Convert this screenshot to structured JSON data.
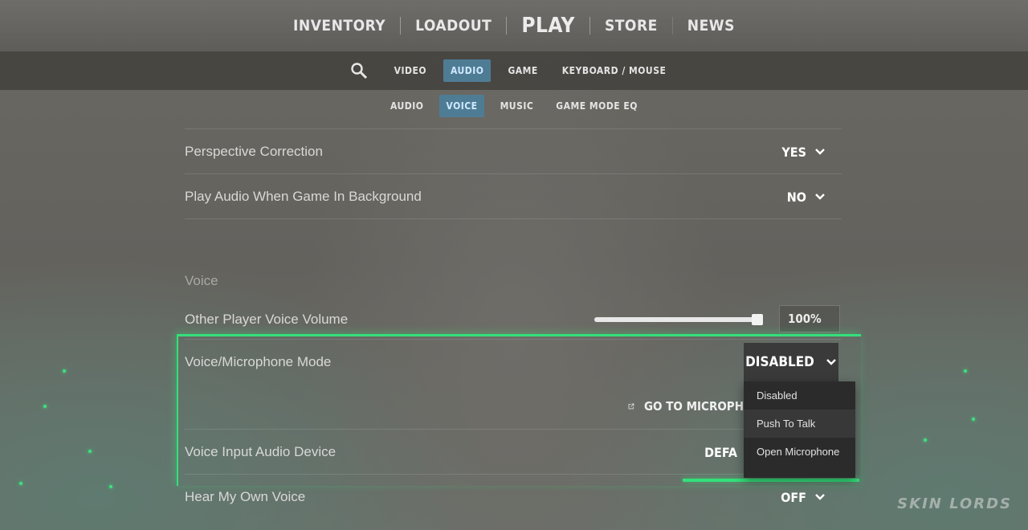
{
  "top_nav": {
    "items": [
      "INVENTORY",
      "LOADOUT",
      "PLAY",
      "STORE",
      "NEWS"
    ]
  },
  "settings_tabs": {
    "items": [
      "VIDEO",
      "AUDIO",
      "GAME",
      "KEYBOARD / MOUSE"
    ],
    "active": "AUDIO"
  },
  "audio_subtabs": {
    "items": [
      "AUDIO",
      "VOICE",
      "MUSIC",
      "GAME MODE EQ"
    ],
    "active": "VOICE"
  },
  "rows": {
    "perspective_correction": {
      "label": "Perspective Correction",
      "value": "YES"
    },
    "play_audio_background": {
      "label": "Play Audio When Game In Background",
      "value": "NO"
    },
    "voice_section_title": "Voice",
    "other_player_voice_volume": {
      "label": "Other Player Voice Volume",
      "value": "100%",
      "level": 1.0
    },
    "voice_mic_mode": {
      "label": "Voice/Microphone Mode",
      "value": "DISABLED"
    },
    "go_to_microphone": {
      "label": "GO TO MICROPH"
    },
    "voice_input_device": {
      "label": "Voice Input Audio Device",
      "value": "DEFA"
    },
    "hear_own_voice": {
      "label": "Hear My Own Voice",
      "value": "OFF"
    }
  },
  "mode_dropdown": {
    "options": [
      "Disabled",
      "Push To Talk",
      "Open Microphone"
    ],
    "hovered": "Push To Talk"
  },
  "watermark": "SKIN LORDS",
  "colors": {
    "accent_tab": "#4f7c95",
    "highlight_green": "#33e07a"
  }
}
